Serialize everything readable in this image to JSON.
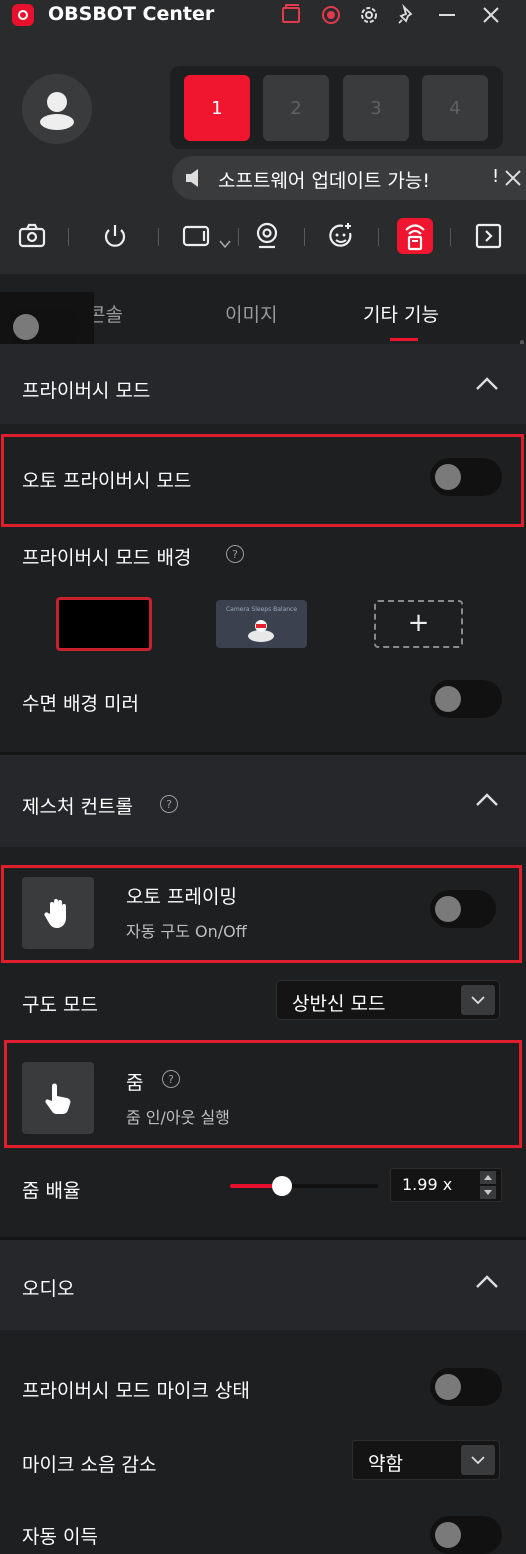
{
  "app": {
    "title": "OBSBOT Center"
  },
  "header": {
    "cameras": [
      "1",
      "2",
      "3",
      "4"
    ],
    "active_camera": "1",
    "update_banner": "소프트웨어 업데이트 가능!",
    "update_excl": "!"
  },
  "tabs": [
    {
      "label": "콘솔"
    },
    {
      "label": "이미지"
    },
    {
      "label": "기타 기능",
      "active": true
    }
  ],
  "privacy": {
    "title": "프라이버시 모드",
    "auto_privacy_label": "오토 프라이버시 모드",
    "background_label": "프라이버시 모드 배경",
    "background_thumb_text": "Camera Sleeps Balance",
    "add_symbol": "+",
    "sleep_mirror_label": "수면 배경 미러"
  },
  "gesture": {
    "title": "제스처 컨트롤",
    "auto_framing_title": "오토 프레이밍",
    "auto_framing_desc": "자동 구도 On/Off",
    "composition_label": "구도 모드",
    "composition_value": "상반신 모드",
    "zoom_title": "줌",
    "zoom_desc": "줌 인/아웃 실행",
    "zoom_ratio_label": "줌 배율",
    "zoom_value": "1.99 x",
    "zoom_slider_fraction": 0.35
  },
  "audio": {
    "title": "오디오",
    "privacy_mic_label": "프라이버시 모드 마이크 상태",
    "noise_label": "마이크 소음 감소",
    "noise_value": "약함",
    "auto_label": "자동 이득"
  },
  "colors": {
    "accent": "#f0162f",
    "panel": "#2a2b2d",
    "background": "#1e1f21",
    "highlight_box": "#e01e2d"
  }
}
